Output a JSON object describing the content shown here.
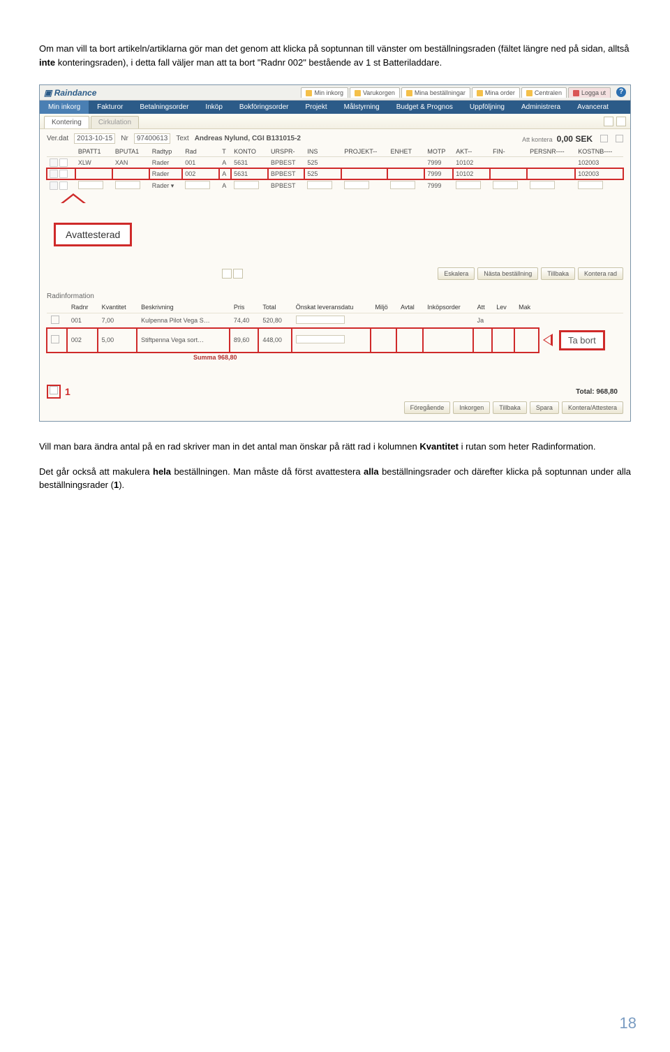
{
  "intro": {
    "text_1": "Om man vill ta bort artikeln/artiklarna gör man det genom att klicka på soptunnan till vänster om beställningsraden (fältet längre ned på sidan, alltså ",
    "bold_1": "inte",
    "text_2": " konteringsraden), i detta fall väljer man att ta bort \"Radnr 002\" bestående av 1 st Batteriladdare."
  },
  "app": {
    "brand": "Raindance",
    "top_links": [
      "Min inkorg",
      "Varukorgen",
      "Mina beställningar",
      "Mina order",
      "Centralen",
      "Logga ut"
    ],
    "main_nav": [
      "Min inkorg",
      "Fakturor",
      "Betalningsorder",
      "Inköp",
      "Bokföringsorder",
      "Projekt",
      "Målstyrning",
      "Budget & Prognos",
      "Uppföljning",
      "Administrera",
      "Avancerat"
    ],
    "main_nav_active": "Min inkorg",
    "sub_tabs": {
      "active": "Kontering",
      "other": "Cirkulation"
    }
  },
  "header_row": {
    "verdat_label": "Ver.dat",
    "verdat": "2013-10-15",
    "nr_label": "Nr",
    "nr": "97400613",
    "text_label": "Text",
    "text": "Andreas Nylund, CGI B131015-2",
    "attk_label": "Att kontera",
    "amount": "0,00 SEK"
  },
  "grid": {
    "columns": [
      "BPATT1",
      "BPUTA1",
      "Radtyp",
      "Rad",
      "T",
      "KONTO",
      "URSPR-",
      "INS",
      "PROJEKT--",
      "ENHET",
      "MOTP",
      "AKT--",
      "FIN-",
      "PERSNR----",
      "KOSTNB----"
    ],
    "rows": [
      {
        "cells": [
          "XLW",
          "XAN",
          "Rader",
          "001",
          "A",
          "5631",
          "BPBEST",
          "525",
          "",
          "",
          "7999",
          "10102",
          "",
          "",
          "102003"
        ],
        "hl": false
      },
      {
        "cells": [
          "",
          "",
          "Rader",
          "002",
          "A",
          "5631",
          "BPBEST",
          "525",
          "",
          "",
          "7999",
          "10102",
          "",
          "",
          "102003"
        ],
        "hl": true
      },
      {
        "cells": [
          "",
          "",
          "Rader ▾",
          "",
          "A",
          "",
          "BPBEST",
          "",
          "",
          "",
          "7999",
          "",
          "",
          "",
          ""
        ],
        "hl": false,
        "input": true
      }
    ]
  },
  "annot": {
    "avattesterad": "Avattesterad",
    "tabort": "Ta bort"
  },
  "midbar": {
    "buttons": [
      "Eskalera",
      "Nästa beställning",
      "Tillbaka",
      "Kontera rad"
    ]
  },
  "radinfo": {
    "title": "Radinformation",
    "columns": [
      "Radnr",
      "Kvantitet",
      "Beskrivning",
      "Pris",
      "Total",
      "Önskat leveransdatu",
      "Miljö",
      "Avtal",
      "Inköpsorder",
      "Att",
      "Lev",
      "Mak"
    ],
    "rows": [
      {
        "radnr": "001",
        "kvantitet": "7,00",
        "beskrivning": "Kulpenna Pilot Vega S…",
        "pris": "74,40",
        "total": "520,80",
        "ja": "Ja",
        "sel": false
      },
      {
        "radnr": "002",
        "kvantitet": "5,00",
        "beskrivning": "Stiftpenna Vega sort…",
        "pris": "89,60",
        "total": "448,00",
        "ja": "",
        "sel": true
      }
    ],
    "summa_label": "Summa 968,80",
    "total_label": "Total:",
    "total_value": "968,80"
  },
  "footer_buttons": [
    "Föregående",
    "Inkorgen",
    "Tillbaka",
    "Spara",
    "Kontera/Attestera"
  ],
  "annot_one": "1",
  "outro": {
    "p1a": "Vill man bara ändra antal på en rad skriver man in det antal man önskar på rätt rad i kolumnen ",
    "p1b": "Kvantitet",
    "p1c": " i rutan som heter Radinformation.",
    "p2a": "Det går också att makulera ",
    "p2b": "hela",
    "p2c": " beställningen. Man måste då först avattestera ",
    "p2d": "alla",
    "p2e": " beställningsrader och därefter klicka på soptunnan under alla beställningsrader (",
    "p2f": "1",
    "p2g": ")."
  },
  "page_number": "18"
}
